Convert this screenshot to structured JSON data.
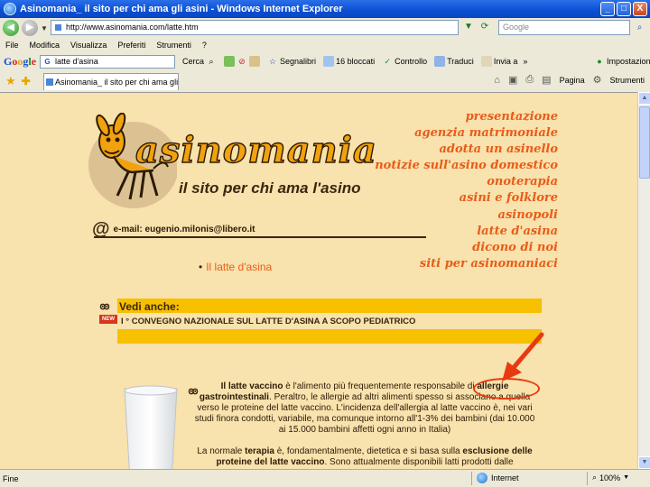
{
  "window": {
    "title": "Asinomania_ il sito per chi ama gli asini - Windows Internet Explorer",
    "buttons": [
      "_",
      "□",
      "X"
    ]
  },
  "addressbar": {
    "url": "http://www.asinomania.com/latte.htm",
    "search_placeholder": "Google"
  },
  "menu": [
    "File",
    "Modifica",
    "Visualizza",
    "Preferiti",
    "Strumenti",
    "?"
  ],
  "google_toolbar": {
    "logo": "Google",
    "search_value": "latte d'asina",
    "items": [
      {
        "label": "Cerca",
        "icon": "search-icon"
      },
      {
        "label": "Segnalibri",
        "icon": "star-icon"
      },
      {
        "label": "16 bloccati",
        "icon": "popup-blocker-icon"
      },
      {
        "label": "Controllo",
        "icon": "spellcheck-icon"
      },
      {
        "label": "Traduci",
        "icon": "translate-icon"
      },
      {
        "label": "Invia a",
        "icon": "send-icon"
      }
    ],
    "settings": "Impostazioni"
  },
  "tab": {
    "title": "Asinomania_ il sito per chi ama gli asini"
  },
  "command_bar": {
    "page": "Pagina",
    "tools": "Strumenti"
  },
  "page": {
    "logo_text": "asinomania",
    "tagline": "il sito per chi ama l'asino",
    "email": "e-mail: eugenio.milonis@libero.it",
    "nav": [
      "presentazione",
      "agenzia matrimoniale",
      "adotta un asinello",
      "notizie sull'asino domestico",
      "onoterapia",
      "asini e folklore",
      "asinopoli",
      "latte d'asina",
      "dicono di noi",
      "siti per asinomaniaci"
    ],
    "bullet_link": "Il latte d'asina",
    "vedi_anche": {
      "title": "Vedi anche:",
      "badge": "NEW",
      "link": "I ° CONVEGNO NAZIONALE SUL LATTE D'ASINA A SCOPO PEDIATRICO"
    },
    "article": {
      "p1_a": "Il latte vaccino",
      "p1_b": " è l'alimento più frequentemente responsabile di ",
      "p1_c": "allergie gastrointestinali",
      "p1_d": ". Peraltro, le allergie ad altri alimenti spesso si associano a quella verso le proteine del latte vaccino. L'incidenza dell'allergia al latte vaccino è, nei vari studi finora condotti, variabile, ma comunque intorno all'1-3% dei bambini (dai 10.000 ai 15.000 bambini affetti ogni anno in Italia)",
      "p2_a": "La normale ",
      "p2_b": "terapia",
      "p2_c": " è, fondamentalmente, dietetica e si basa sulla ",
      "p2_d": "esclusione delle proteine del latte vaccino",
      "p2_e": ". Sono attualmente disponibili latti prodotti dalle"
    }
  },
  "status": {
    "left": "Fine",
    "zone": "Internet",
    "zoom": "100%"
  },
  "colors": {
    "page_background": "#f8e2ad",
    "menu_orange": "#e85c1a",
    "box_yellow": "#f7c000",
    "annotation_red": "#e83a10"
  }
}
